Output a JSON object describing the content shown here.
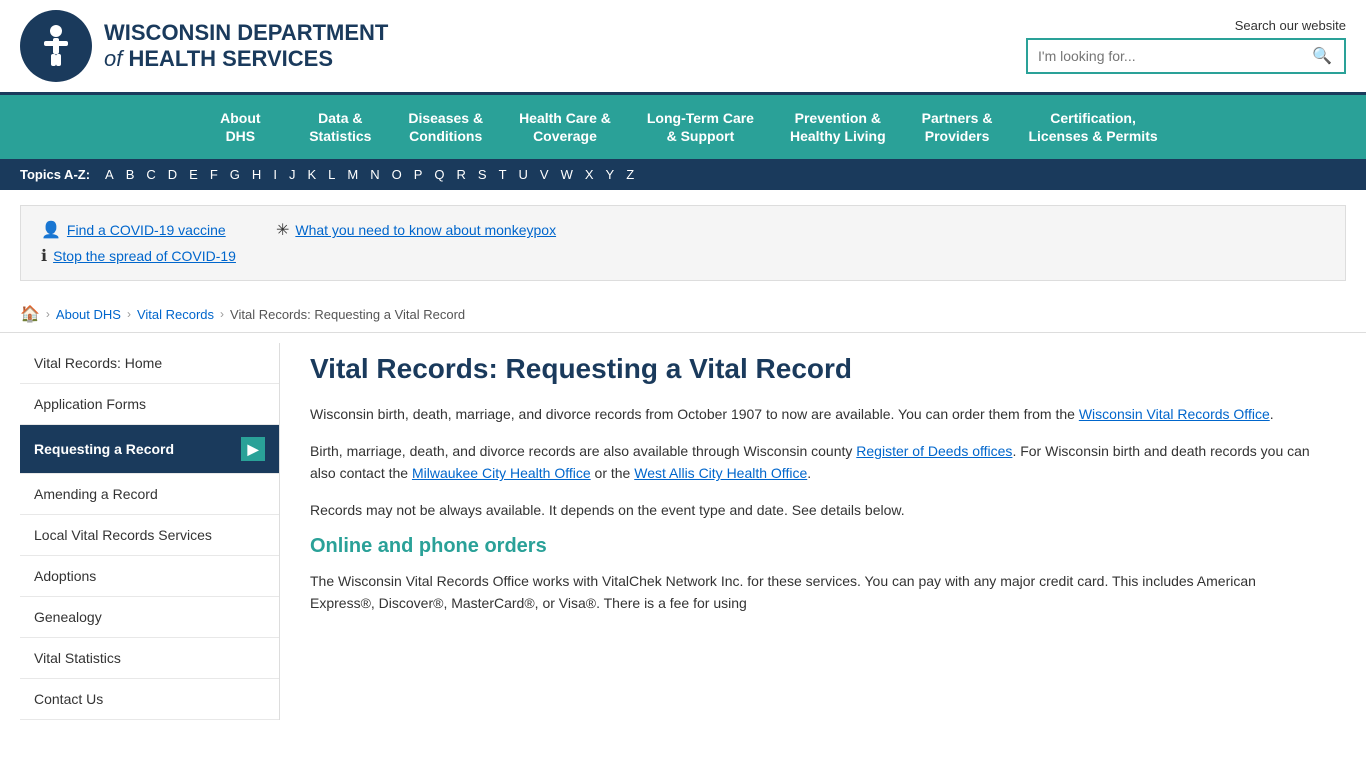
{
  "header": {
    "org_line1": "WISCONSIN DEPARTMENT",
    "org_line2": "of HEALTH SERVICES",
    "search_label": "Search our website",
    "search_placeholder": "I'm looking for..."
  },
  "nav": {
    "items": [
      {
        "id": "about-dhs",
        "label": "About\nDHS"
      },
      {
        "id": "data-statistics",
        "label": "Data &\nStatistics"
      },
      {
        "id": "diseases-conditions",
        "label": "Diseases &\nConditions"
      },
      {
        "id": "health-care-coverage",
        "label": "Health Care &\nCoverage"
      },
      {
        "id": "long-term-care",
        "label": "Long-Term Care\n& Support"
      },
      {
        "id": "prevention-healthy",
        "label": "Prevention &\nHealthy Living"
      },
      {
        "id": "partners-providers",
        "label": "Partners &\nProviders"
      },
      {
        "id": "certification-licenses",
        "label": "Certification,\nLicenses & Permits"
      }
    ]
  },
  "az_bar": {
    "label": "Topics A-Z:",
    "letters": [
      "A",
      "B",
      "C",
      "D",
      "E",
      "F",
      "G",
      "H",
      "I",
      "J",
      "K",
      "L",
      "M",
      "N",
      "O",
      "P",
      "Q",
      "R",
      "S",
      "T",
      "U",
      "V",
      "W",
      "X",
      "Y",
      "Z"
    ]
  },
  "alerts": {
    "left": [
      {
        "icon": "👤",
        "text": "Find a COVID-19 vaccine",
        "href": "#"
      },
      {
        "icon": "ℹ",
        "text": "Stop the spread of COVID-19",
        "href": "#"
      }
    ],
    "right": [
      {
        "icon": "✳",
        "text": "What you need to know about monkeypox",
        "href": "#"
      }
    ]
  },
  "breadcrumb": {
    "home_icon": "🏠",
    "items": [
      {
        "label": "About DHS",
        "href": "#"
      },
      {
        "label": "Vital Records",
        "href": "#"
      },
      {
        "label": "Vital Records: Requesting a Vital Record",
        "href": "#",
        "current": true
      }
    ]
  },
  "sidebar": {
    "items": [
      {
        "id": "vital-records-home",
        "label": "Vital Records: Home",
        "active": false
      },
      {
        "id": "application-forms",
        "label": "Application Forms",
        "active": false
      },
      {
        "id": "requesting-record",
        "label": "Requesting a Record",
        "active": true
      },
      {
        "id": "amending-record",
        "label": "Amending a Record",
        "active": false
      },
      {
        "id": "local-vital-records",
        "label": "Local Vital Records Services",
        "active": false
      },
      {
        "id": "adoptions",
        "label": "Adoptions",
        "active": false
      },
      {
        "id": "genealogy",
        "label": "Genealogy",
        "active": false
      },
      {
        "id": "vital-statistics",
        "label": "Vital Statistics",
        "active": false
      },
      {
        "id": "contact-us",
        "label": "Contact Us",
        "active": false
      }
    ]
  },
  "content": {
    "page_title": "Vital Records: Requesting a Vital Record",
    "para1": "Wisconsin birth, death, marriage, and divorce records from October 1907 to now are available. You can order them from the Wisconsin Vital Records Office.",
    "para1_link": "Wisconsin Vital Records Office",
    "para2_before": "Birth, marriage, death, and divorce records are also available through Wisconsin county ",
    "para2_link1": "Register of Deeds offices",
    "para2_middle": ". For Wisconsin birth and death records you can also contact the ",
    "para2_link2": "Milwaukee City Health Office",
    "para2_or": " or the ",
    "para2_link3": "West Allis City Health Office",
    "para2_end": ".",
    "para3": "Records may not be always available. It depends on the event type and date. See details below.",
    "section_title": "Online and phone orders",
    "para4": "The Wisconsin Vital Records Office works with VitalChek Network Inc. for these services. You can pay with any major credit card. This includes American Express®, Discover®, MasterCard®, or Visa®. There is a fee for using"
  }
}
